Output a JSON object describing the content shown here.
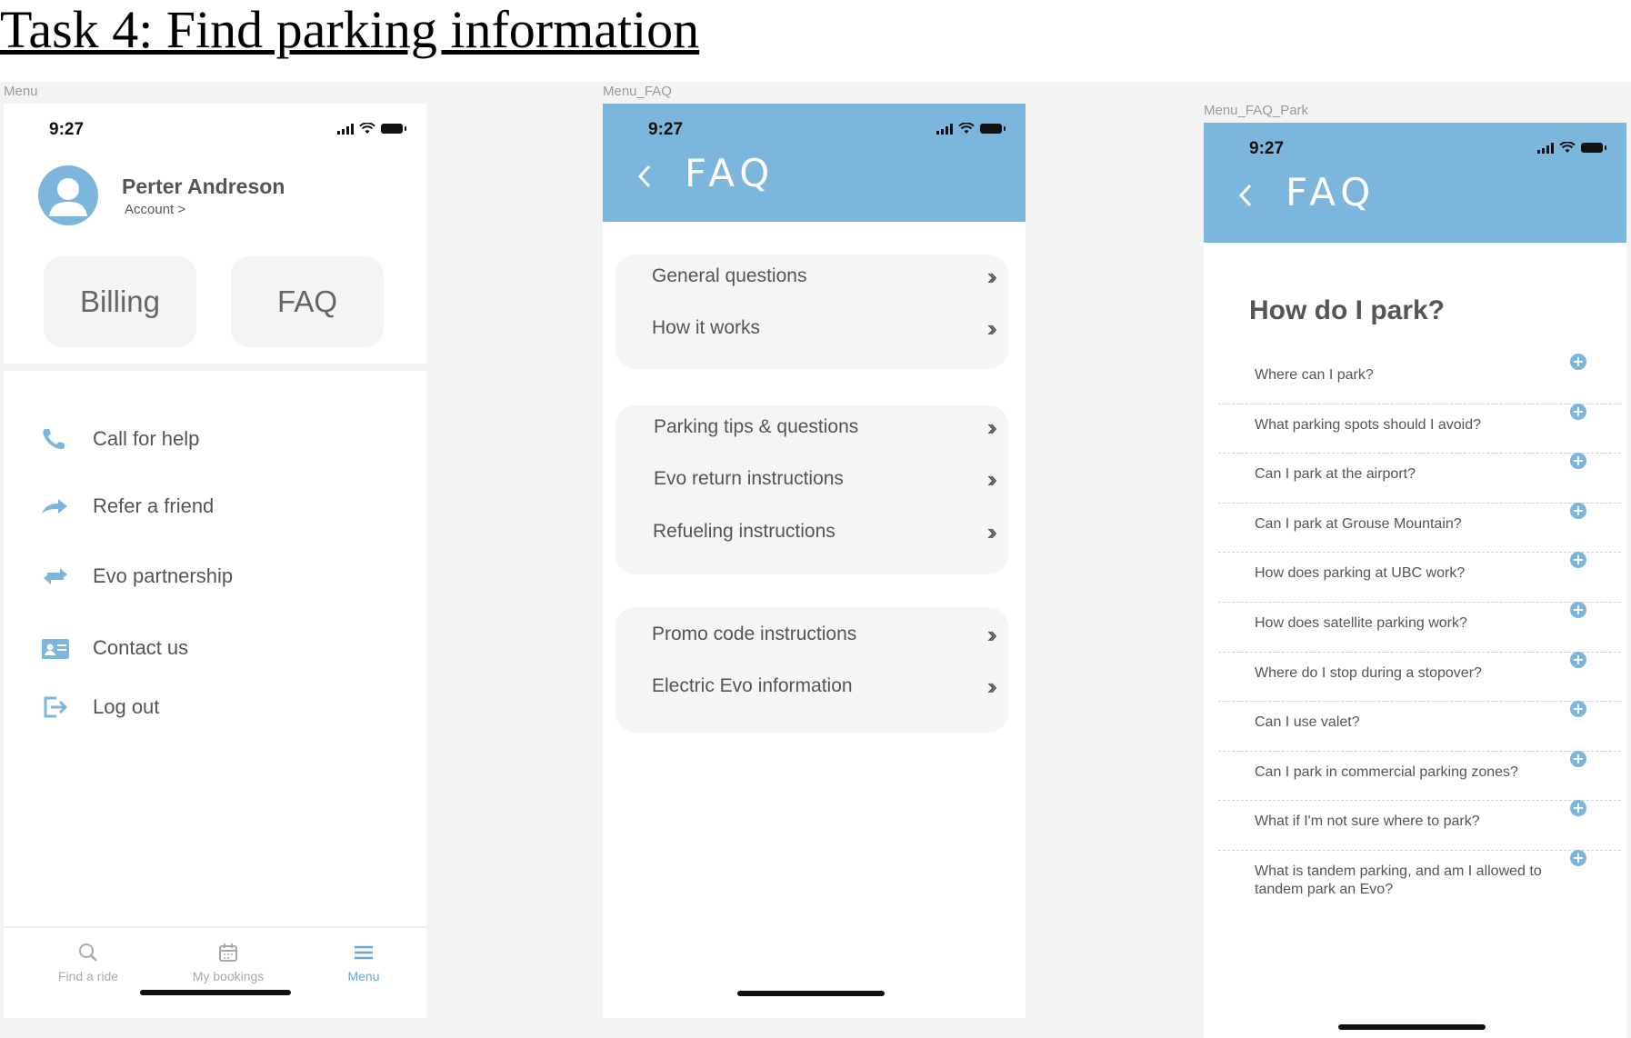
{
  "task_title": "Task 4: Find parking information",
  "frames": {
    "menu": "Menu",
    "faq": "Menu_FAQ",
    "faq_park": "Menu_FAQ_Park"
  },
  "status_time": "9:27",
  "accent_color": "#7db6dc",
  "menu_screen": {
    "profile_name": "Perter Andreson",
    "account_link": "Account >",
    "tiles": [
      "Billing",
      "FAQ"
    ],
    "items": [
      {
        "label": "Call for help",
        "icon": "phone-icon"
      },
      {
        "label": "Refer a friend",
        "icon": "share-arrow-icon"
      },
      {
        "label": "Evo partnership",
        "icon": "exchange-icon"
      },
      {
        "label": "Contact us",
        "icon": "contact-card-icon"
      },
      {
        "label": "Log out",
        "icon": "logout-icon"
      }
    ],
    "tabs": [
      {
        "label": "Find a ride",
        "icon": "search-icon"
      },
      {
        "label": "My bookings",
        "icon": "calendar-icon"
      },
      {
        "label": "Menu",
        "icon": "menu-icon",
        "active": true
      }
    ]
  },
  "faq_screen": {
    "title": "FAQ",
    "groups": [
      [
        "General questions",
        "How it works"
      ],
      [
        "Parking tips & questions",
        "Evo return instructions",
        "Refueling instructions"
      ],
      [
        "Promo code instructions",
        "Electric Evo information"
      ]
    ]
  },
  "faq_park_screen": {
    "title": "FAQ",
    "heading": "How do I park?",
    "questions": [
      "Where  can I park?",
      "What parking spots should I avoid?",
      "Can I park at the airport?",
      "Can I park at Grouse Mountain?",
      "How does parking at UBC work?",
      "How does satellite parking work?",
      "Where do I stop during a stopover?",
      "Can I use valet?",
      "Can I park in commercial parking zones?",
      "What if I'm not sure where to park?",
      "What is tandem parking, and am I allowed to tandem park an Evo?"
    ]
  }
}
